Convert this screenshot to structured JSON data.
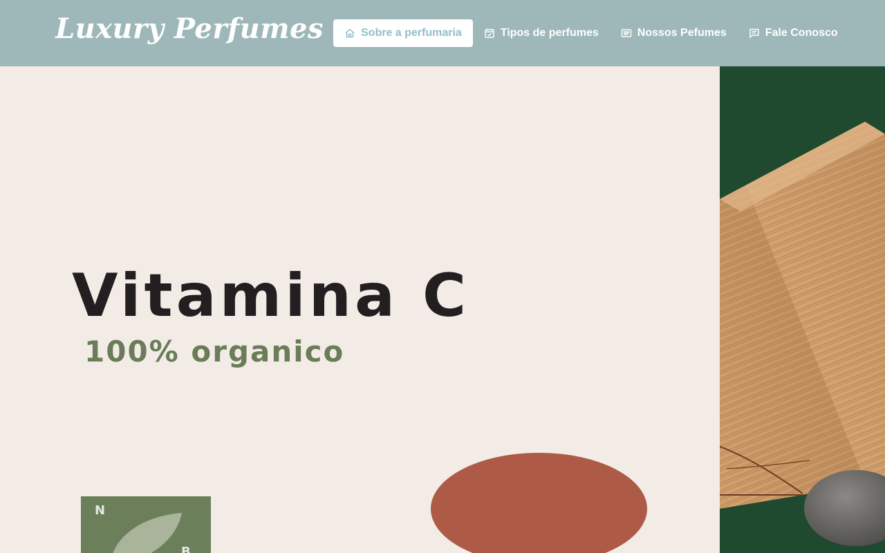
{
  "brand": "Luxury Perfumes",
  "nav": {
    "items": [
      {
        "label": "Sobre a perfumaria",
        "icon": "home-icon",
        "active": true
      },
      {
        "label": "Tipos de perfumes",
        "icon": "calendar-check-icon",
        "active": false
      },
      {
        "label": "Nossos Pefumes",
        "icon": "list-box-icon",
        "active": false
      },
      {
        "label": "Fale Conosco",
        "icon": "chat-lines-icon",
        "active": false
      }
    ]
  },
  "hero": {
    "title": "Vitamina C",
    "subtitle": "100% organico",
    "badge_letters": [
      "N",
      "B"
    ]
  },
  "colors": {
    "navbar": "#9eb8ba",
    "active_text": "#8fbfc7",
    "hero_bg": "#f3ebe6",
    "title": "#231f20",
    "subtitle": "#6a7d58",
    "circle": "#ad5b47",
    "badge": "#6b7f5b",
    "right_bg": "#1f4a2f"
  }
}
